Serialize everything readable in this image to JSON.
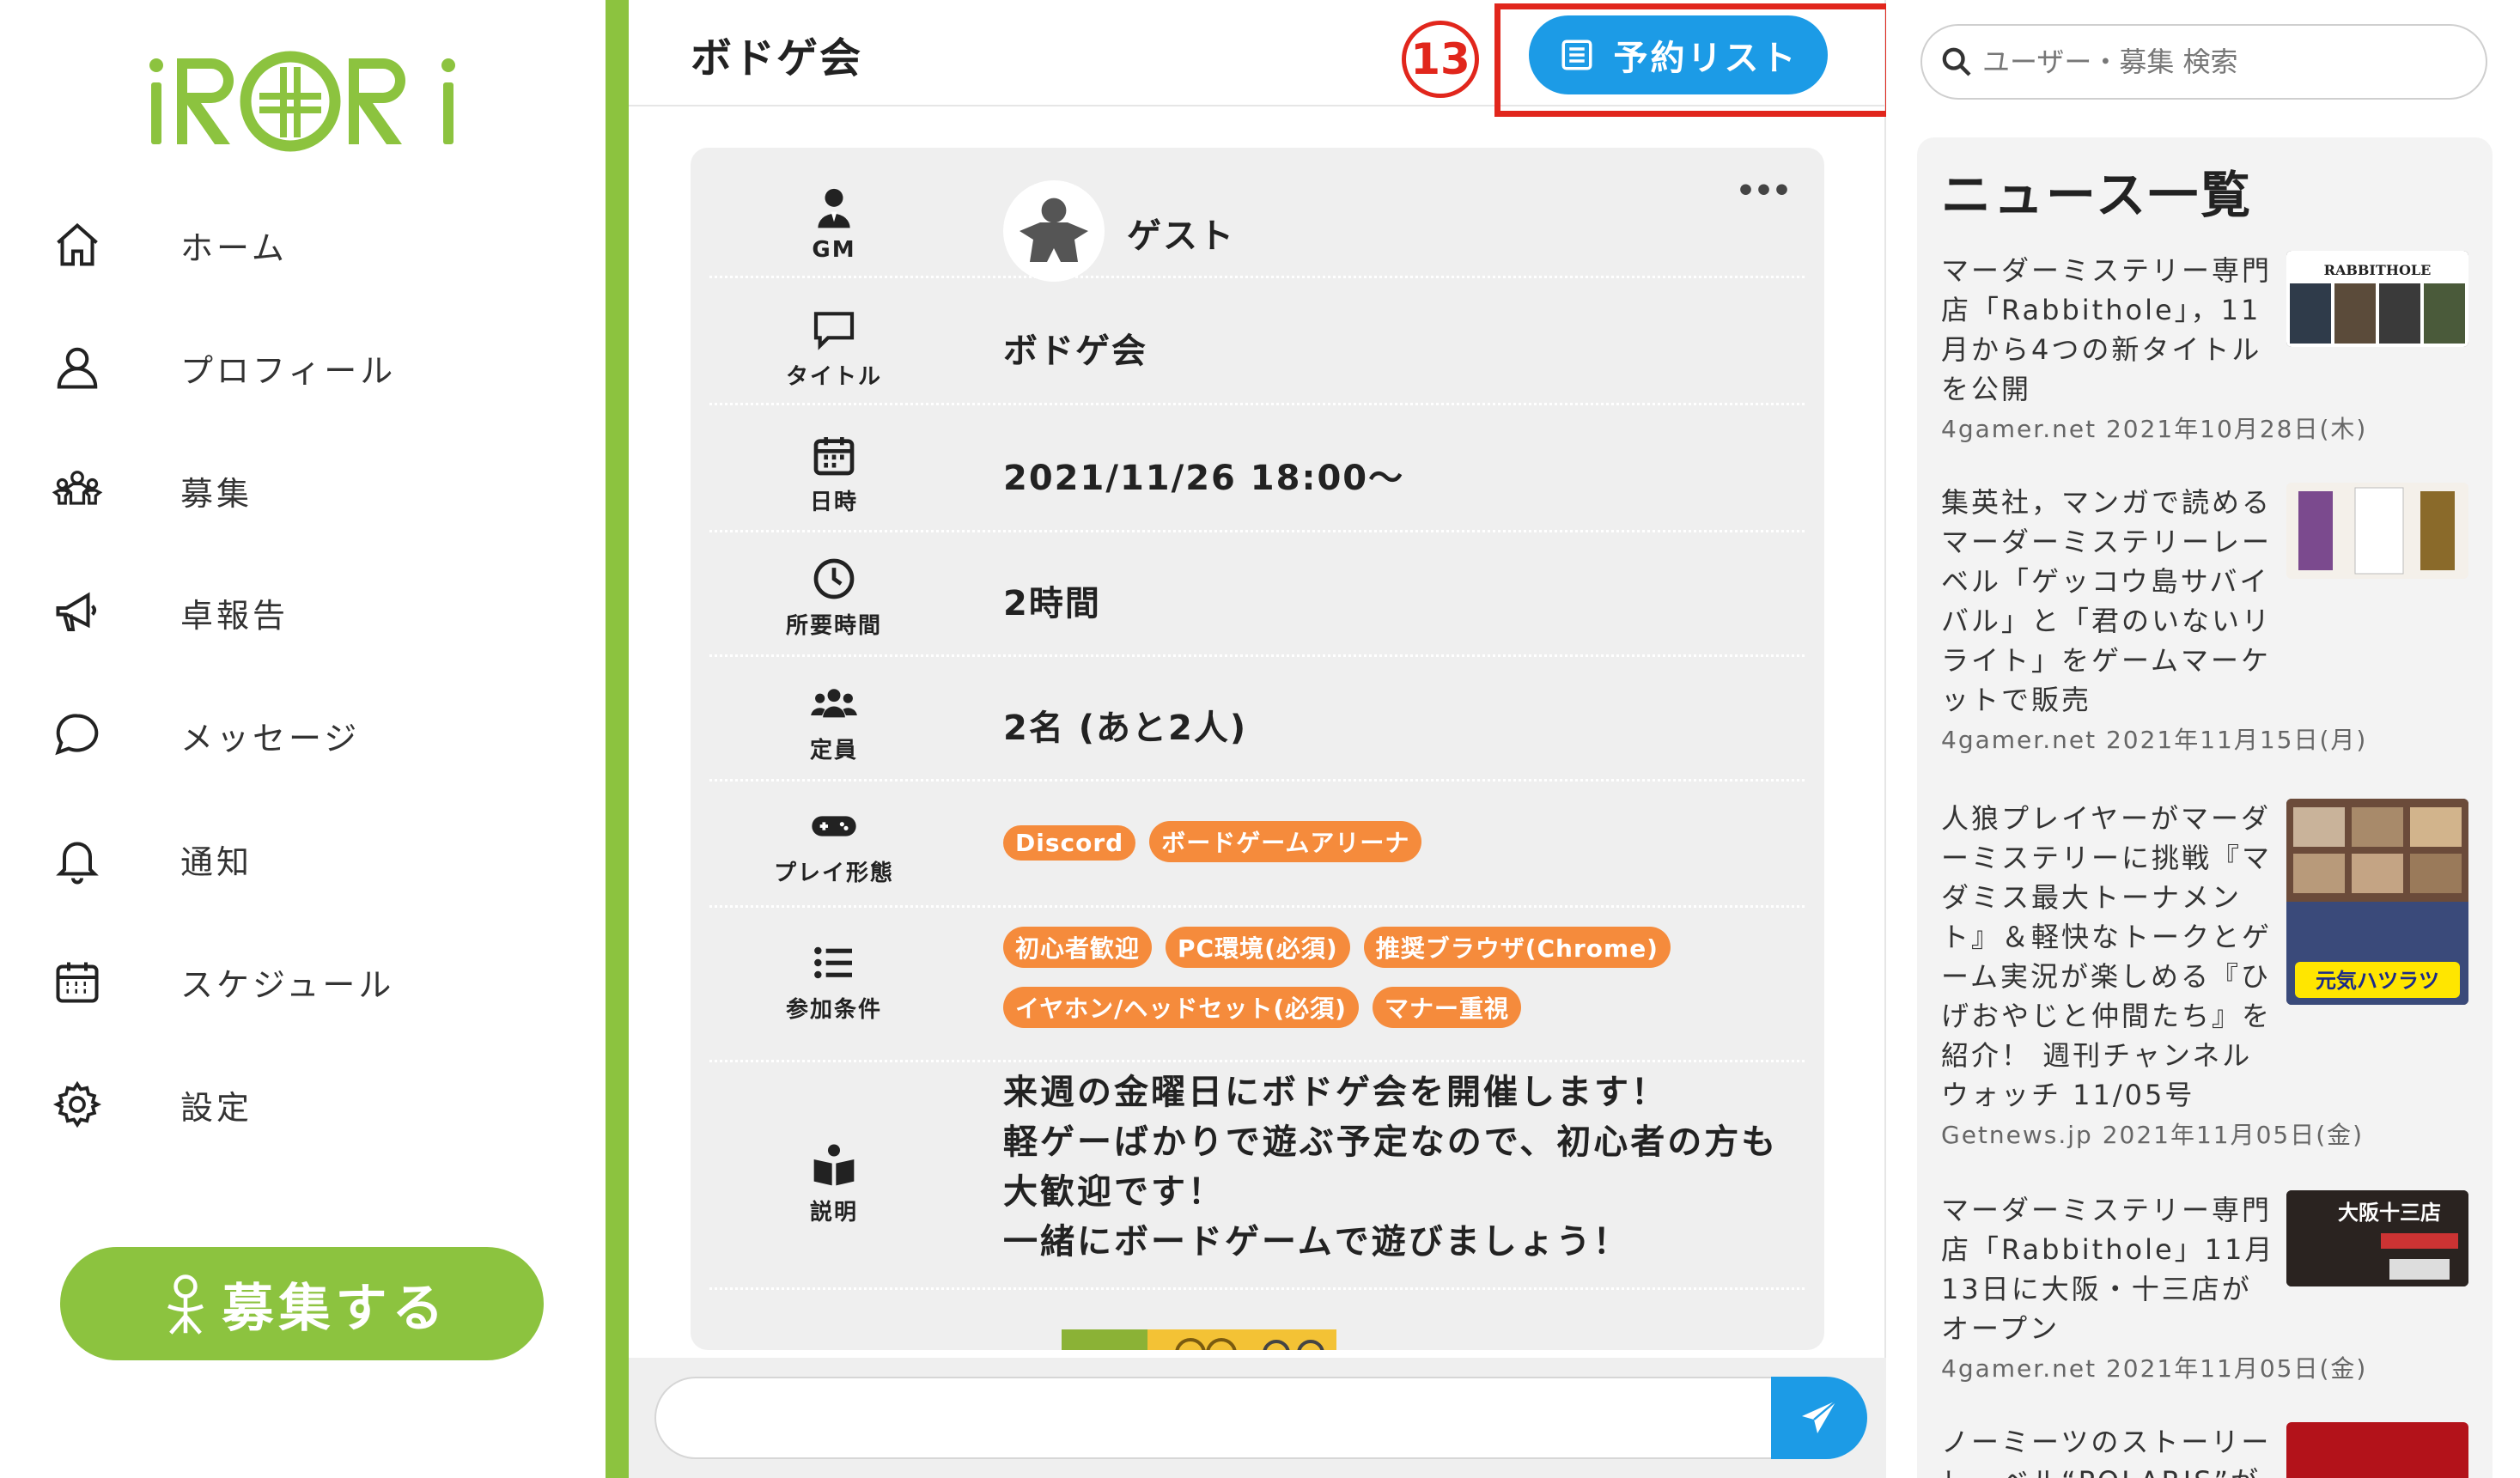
{
  "app": {
    "logo_text": "iRORi",
    "colors": {
      "brand_green": "#8cc33f",
      "accent_blue": "#1c9be6",
      "tag_orange": "#f58b3c",
      "annotation_red": "#e1261c"
    }
  },
  "nav": {
    "items": [
      {
        "label": "ホーム",
        "icon": "home-icon"
      },
      {
        "label": "プロフィール",
        "icon": "user-icon"
      },
      {
        "label": "募集",
        "icon": "meeple-group-icon"
      },
      {
        "label": "卓報告",
        "icon": "megaphone-icon"
      },
      {
        "label": "メッセージ",
        "icon": "chat-icon"
      },
      {
        "label": "通知",
        "icon": "bell-icon"
      },
      {
        "label": "スケジュール",
        "icon": "calendar-icon"
      },
      {
        "label": "設定",
        "icon": "gear-icon"
      }
    ],
    "recruit_button": "募集する"
  },
  "header": {
    "title": "ボドゲ会",
    "step_marker": "13",
    "reserve_list_button": "予約リスト"
  },
  "detail": {
    "more": "•••",
    "gm": {
      "label": "GM",
      "name": "ゲスト"
    },
    "title": {
      "label": "タイトル",
      "value": "ボドゲ会"
    },
    "datetime": {
      "label": "日時",
      "value": "2021/11/26 18:00〜"
    },
    "duration": {
      "label": "所要時間",
      "value": "2時間"
    },
    "capacity": {
      "label": "定員",
      "value": "2名 (あと2人)"
    },
    "play_style": {
      "label": "プレイ形態",
      "tags": [
        "Discord",
        "ボードゲームアリーナ"
      ]
    },
    "conditions": {
      "label": "参加条件",
      "tags_row1": [
        "初心者歓迎",
        "PC環境(必須)",
        "推奨ブラウザ(Chrome)"
      ],
      "tags_row2": [
        "イヤホン/ヘッドセット(必須)",
        "マナー重視"
      ]
    },
    "description": {
      "label": "説明",
      "text": "来週の金曜日にボドゲ会を開催します！\n軽ゲーばかりで遊ぶ予定なので、初心者の方も\n大歓迎です！\n一緒にボードゲームで遊びましょう！"
    }
  },
  "compose": {
    "placeholder": ""
  },
  "search": {
    "placeholder": "ユーザー・募集 検索"
  },
  "news": {
    "title": "ニュース一覧",
    "items": [
      {
        "headline": "マーダーミステリー専門店「Rabbithole」，11月から4つの新タイトルを公開",
        "meta": "4gamer.net 2021年10月28日(木)"
      },
      {
        "headline": "集英社，マンガで読めるマーダーミステリーレーベル「ゲッコウ島サバイバル」と「君のいないリライト」をゲームマーケットで販売",
        "meta": "4gamer.net 2021年11月15日(月)"
      },
      {
        "headline": "人狼プレイヤーがマーダーミステリーに挑戦『マダミス最大トーナメント』＆軽快なトークとゲーム実況が楽しめる『ひげおやじと仲間たち』を紹介！ 週刊チャンネルウォッチ 11/05号",
        "meta": "Getnews.jp 2021年11月05日(金)"
      },
      {
        "headline": "マーダーミステリー専門店「Rabbithole」11月13日に大阪・十三店がオープン",
        "meta": "4gamer.net 2021年11月05日(金)"
      },
      {
        "headline": "ノーミーツのストーリーレーベル“POLARIS”が",
        "meta": ""
      }
    ],
    "thumb_texts": [
      "RABBITHOLE",
      "",
      "元気ハツラツ",
      "大阪十三店",
      ""
    ]
  }
}
